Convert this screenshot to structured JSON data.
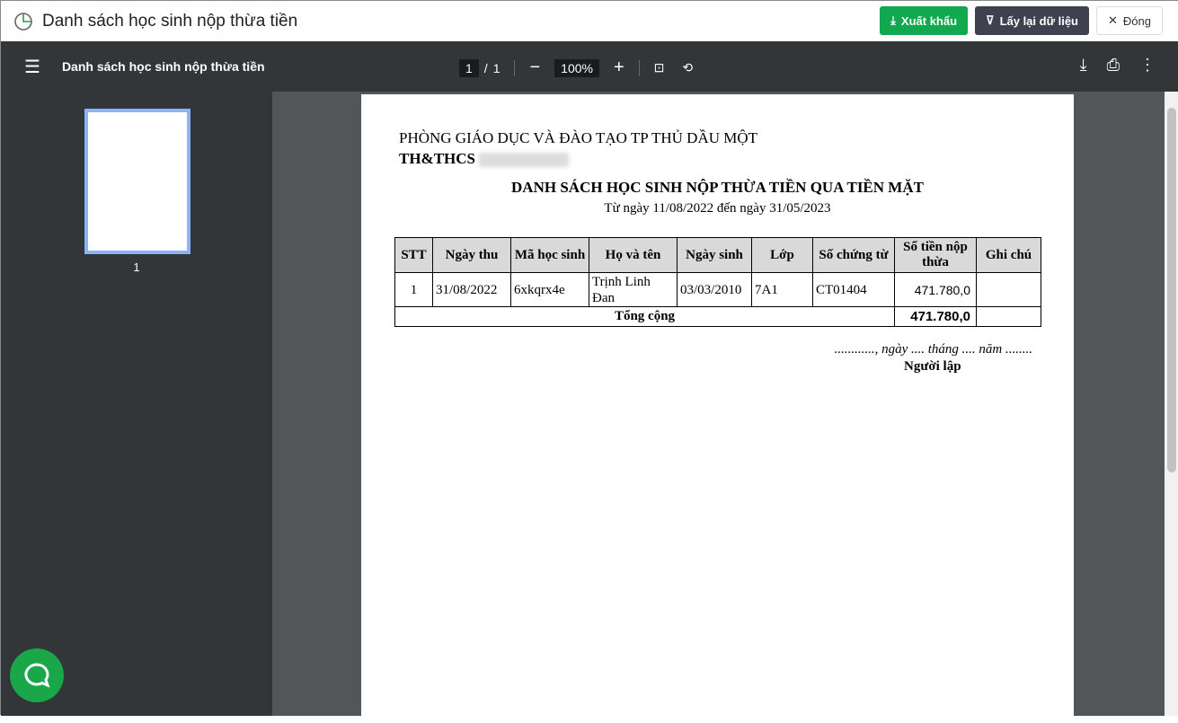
{
  "header": {
    "title": "Danh sách học sinh nộp thừa tiền",
    "export": "Xuất khẩu",
    "reload": "Lấy lại dữ liệu",
    "close": "Đóng"
  },
  "viewer": {
    "doc_title": "Danh sách học sinh nộp thừa tiền",
    "page": "1",
    "total": "1",
    "zoom": "100%",
    "thumb_label": "1"
  },
  "doc": {
    "dept": "PHÒNG GIÁO DỤC VÀ ĐÀO TẠO TP THỦ DẦU MỘT",
    "school": "TH&THCS",
    "title": "DANH SÁCH HỌC SINH NỘP THỪA TIỀN QUA TIỀN MẶT",
    "range": "Từ ngày 11/08/2022 đến ngày 31/05/2023",
    "columns": [
      "STT",
      "Ngày thu",
      "Mã học sinh",
      "Họ và tên",
      "Ngày sinh",
      "Lớp",
      "Số chứng từ",
      "Số tiền nộp thừa",
      "Ghi chú"
    ],
    "rows": [
      [
        "1",
        "31/08/2022",
        "6xkqrx4e",
        "Trịnh Linh Đan",
        "03/03/2010",
        "7A1",
        "CT01404",
        "471.780,0",
        ""
      ]
    ],
    "total_label": "Tổng cộng",
    "total_value": "471.780,0",
    "date_line": "............, ngày .... tháng .... năm ........",
    "signer": "Người lập"
  }
}
